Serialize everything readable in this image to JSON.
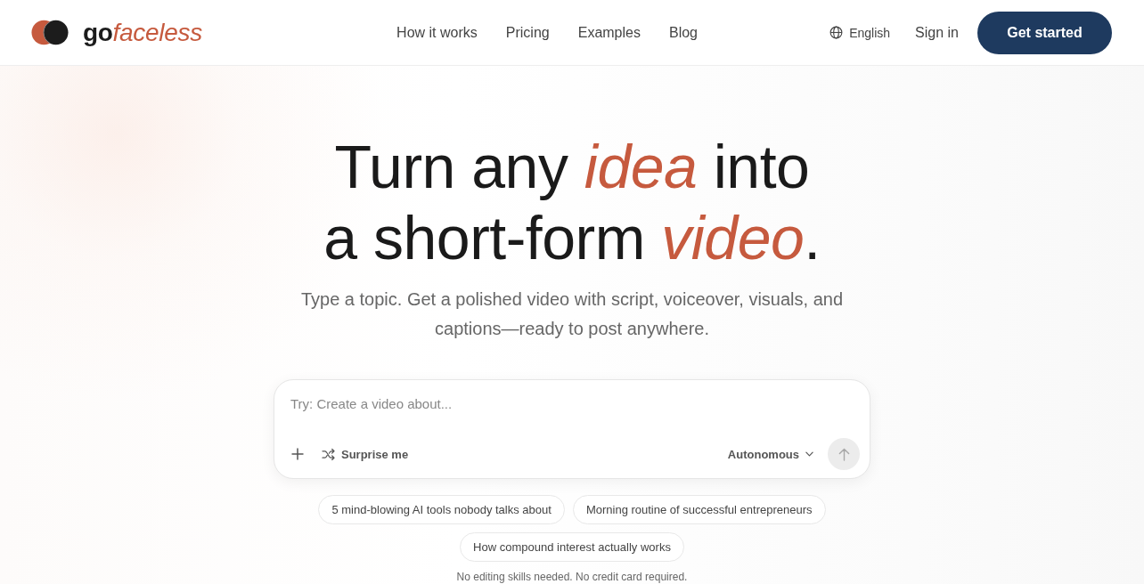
{
  "header": {
    "logo": {
      "parts": [
        "go",
        "faceless"
      ]
    },
    "nav": [
      {
        "label": "How it works"
      },
      {
        "label": "Pricing"
      },
      {
        "label": "Examples"
      },
      {
        "label": "Blog"
      }
    ],
    "language": "English",
    "sign_in": "Sign in",
    "cta": "Get started"
  },
  "hero": {
    "heading": [
      "Turn any *idea* into",
      "a short-form *video*."
    ],
    "subtitle": "Type a topic. Get a polished video with script, voiceover, visuals, and captions—ready to post anywhere."
  },
  "prompt": {
    "placeholder": "Try: Create a video about...",
    "surprise": "Surprise me",
    "mode": "Autonomous",
    "send_button": {
      "disabled": true
    }
  },
  "suggestions": [
    {
      "label": "5 mind-blowing AI tools nobody talks about"
    },
    {
      "label": "Morning routine of successful entrepreneurs"
    },
    {
      "label": "How compound interest actually works"
    }
  ],
  "footnote": "No editing skills needed. No credit card required."
}
